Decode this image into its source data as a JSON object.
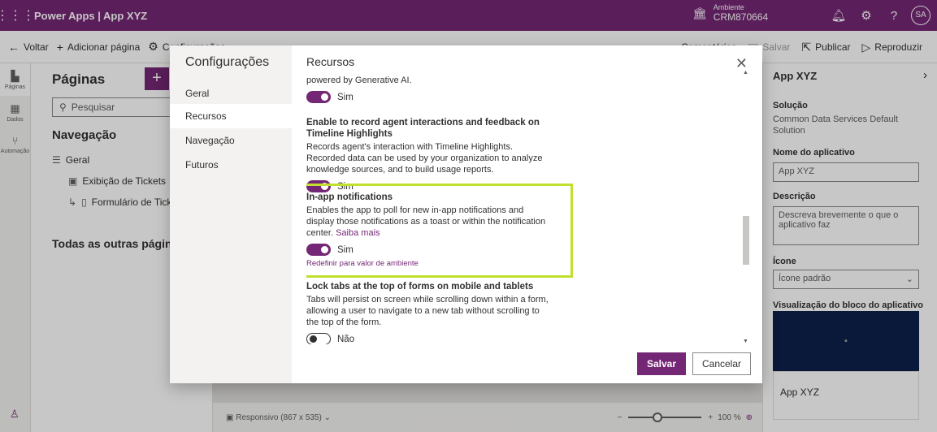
{
  "topbar": {
    "title": "Power Apps  |  App XYZ",
    "env_label": "Ambiente",
    "env_value": "CRM870664",
    "avatar": "SA"
  },
  "cmdbar": {
    "back": "Voltar",
    "add_page": "Adicionar página",
    "settings": "Configurações",
    "comments": "Comentários",
    "save": "Salvar",
    "publish": "Publicar",
    "play": "Reproduzir"
  },
  "rail": {
    "pages": "Páginas",
    "data": "Dados",
    "automation": "Automação"
  },
  "pages": {
    "title": "Páginas",
    "search_placeholder": "Pesquisar",
    "nav_title": "Navegação",
    "group": "Geral",
    "item1": "Exibição de Tickets",
    "item2": "Formulário de Tickets",
    "other": "Todas as outras páginas"
  },
  "canvas": {
    "responsive": "Responsivo (867 x 535)",
    "zoom": "100 %"
  },
  "right_panel": {
    "app_name": "App XYZ",
    "solution_label": "Solução",
    "solution_value": "Common Data Services Default Solution",
    "name_label": "Nome do aplicativo",
    "name_value": "App XYZ",
    "desc_label": "Descrição",
    "desc_placeholder": "Descreva brevemente o que o aplicativo faz",
    "icon_label": "Ícone",
    "icon_value": "Ícone padrão",
    "tile_label": "Visualização do bloco do aplicativo",
    "tile_app": "App XYZ"
  },
  "dialog": {
    "nav_title": "Configurações",
    "nav_items": [
      "Geral",
      "Recursos",
      "Navegação",
      "Futuros"
    ],
    "title": "Recursos",
    "feature0": {
      "desc_tail": "powered by Generative AI.",
      "state": "Sim"
    },
    "feature1": {
      "title": "Enable to record agent interactions and feedback on Timeline Highlights",
      "desc": "Records agent's interaction with Timeline Highlights. Recorded data can be used by your organization to analyze knowledge sources, and to build usage reports.",
      "state": "Sim"
    },
    "feature2": {
      "title": "In-app notifications",
      "desc": "Enables the app to poll for new in-app notifications and display those notifications as a toast or within the notification center.",
      "link": "Saiba mais",
      "state": "Sim",
      "reset": "Redefinir para valor de ambiente"
    },
    "feature3": {
      "title": "Lock tabs at the top of forms on mobile and tablets",
      "desc": "Tabs will persist on screen while scrolling down within a form, allowing a user to navigate to a new tab without scrolling to the top of the form.",
      "state": "Não"
    },
    "save": "Salvar",
    "cancel": "Cancelar"
  },
  "colors": {
    "brand": "#742774",
    "highlight": "#bfe02f"
  }
}
